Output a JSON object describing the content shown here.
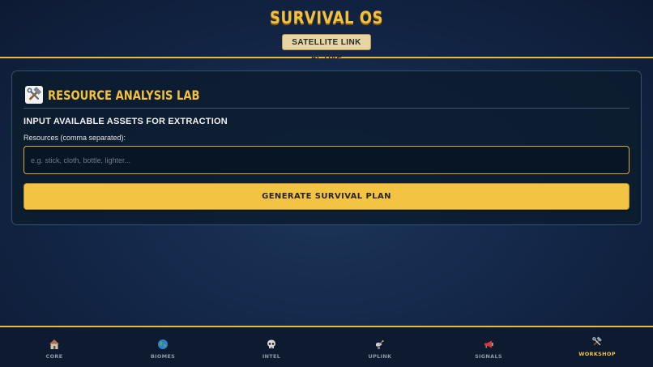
{
  "header": {
    "title": "SURVIVAL OS",
    "status": "SATELLITE LINK ACTIVE"
  },
  "panel": {
    "icon": "hammer-wrench-icon",
    "title": "RESOURCE ANALYSIS LAB",
    "section_heading": "INPUT AVAILABLE ASSETS FOR EXTRACTION",
    "field_label": "Resources (comma separated):",
    "input_value": "",
    "input_placeholder": "e.g. stick, cloth, bottle, lighter...",
    "button_label": "GENERATE SURVIVAL PLAN"
  },
  "nav": {
    "active": "WORKSHOP",
    "items": [
      {
        "label": "CORE",
        "icon": "house-icon"
      },
      {
        "label": "BIOMES",
        "icon": "globe-icon"
      },
      {
        "label": "INTEL",
        "icon": "skull-icon"
      },
      {
        "label": "UPLINK",
        "icon": "satellite-dish-icon"
      },
      {
        "label": "SIGNALS",
        "icon": "megaphone-icon"
      },
      {
        "label": "WORKSHOP",
        "icon": "hammer-wrench-icon"
      }
    ]
  },
  "colors": {
    "accent": "#f3c03f",
    "background": "#14284a",
    "panel": "#0c1c2e"
  }
}
